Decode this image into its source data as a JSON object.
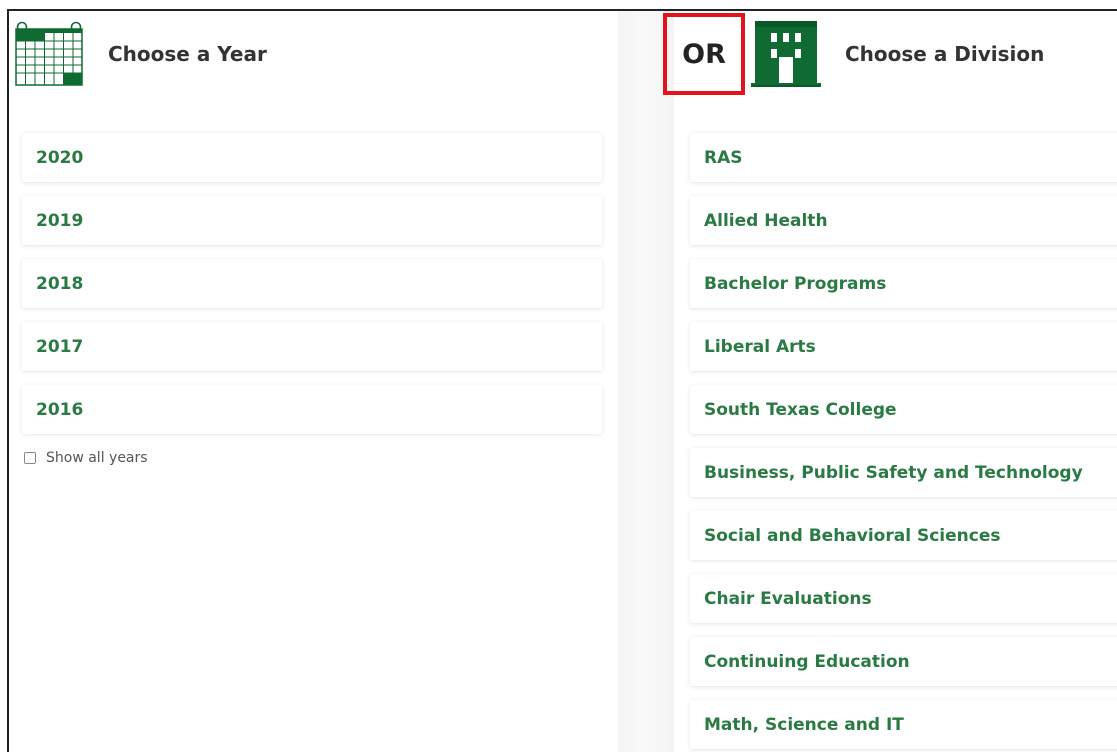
{
  "year_panel": {
    "title": "Choose a Year",
    "icon": "calendar-icon",
    "years": [
      "2020",
      "2019",
      "2018",
      "2017",
      "2016"
    ],
    "show_all_label": "Show all years",
    "show_all_checked": false
  },
  "separator": {
    "label": "OR"
  },
  "division_panel": {
    "title": "Choose a Division",
    "icon": "building-icon",
    "divisions": [
      "RAS",
      "Allied Health",
      "Bachelor Programs",
      "Liberal Arts",
      "South Texas College",
      "Business, Public Safety and Technology",
      "Social and Behavioral Sciences",
      "Chair Evaluations",
      "Continuing Education",
      "Math, Science and IT"
    ]
  },
  "colors": {
    "accent": "#2a7a44",
    "icon_green": "#0f6b32",
    "highlight_red": "#e2141b"
  }
}
